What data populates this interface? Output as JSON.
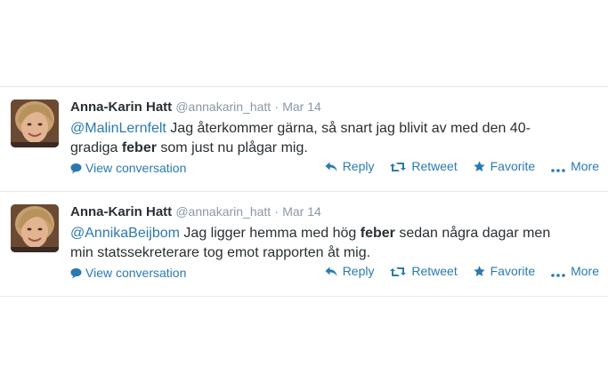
{
  "tweets": [
    {
      "author_name": "Anna-Karin Hatt",
      "username": "@annakarin_hatt",
      "separator": "·",
      "time": "Mar 14",
      "mention": "@MalinLernfelt",
      "text_before": " Jag återkommer gärna, så snart jag blivit av med den 40-gradiga ",
      "bold": "feber",
      "text_after": " som just nu plågar mig.",
      "view_conversation": "View conversation",
      "actions": {
        "reply": "Reply",
        "retweet": "Retweet",
        "favorite": "Favorite",
        "more": "More"
      }
    },
    {
      "author_name": "Anna-Karin Hatt",
      "username": "@annakarin_hatt",
      "separator": "·",
      "time": "Mar 14",
      "mention": "@AnnikaBeijbom",
      "text_before": " Jag ligger hemma med hög ",
      "bold": "feber",
      "text_after": " sedan några dagar men min statssekreterare tog emot rapporten åt mig.",
      "view_conversation": "View conversation",
      "actions": {
        "reply": "Reply",
        "retweet": "Retweet",
        "favorite": "Favorite",
        "more": "More"
      }
    }
  ],
  "colors": {
    "link": "#2a7ab0",
    "meta": "#8899a6",
    "text": "#292f33",
    "divider": "#e1e8ed"
  },
  "icons": [
    "speech-bubble-icon",
    "reply-arrow-icon",
    "retweet-icon",
    "star-icon",
    "more-dots-icon"
  ]
}
